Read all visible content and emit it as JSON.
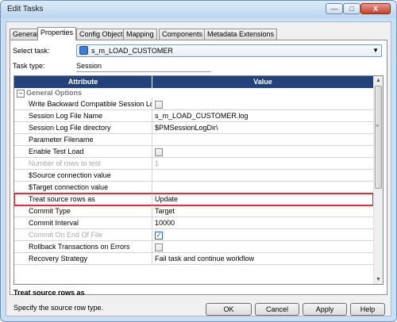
{
  "window": {
    "title": "Edit Tasks",
    "controls": {
      "minimize": "—",
      "maximize": "□",
      "close": "X"
    }
  },
  "tabs": [
    {
      "label": "General"
    },
    {
      "label": "Properties"
    },
    {
      "label": "Config Object"
    },
    {
      "label": "Mapping"
    },
    {
      "label": "Components"
    },
    {
      "label": "Metadata Extensions"
    }
  ],
  "select_task": {
    "label": "Select task:",
    "value": "s_m_LOAD_CUSTOMER"
  },
  "task_type": {
    "label": "Task type:",
    "value": "Session"
  },
  "grid": {
    "headers": {
      "attribute": "Attribute",
      "value": "Value"
    },
    "group": {
      "label": "General Options",
      "toggle": "−"
    },
    "rows": [
      {
        "attribute": "Write Backward Compatible Session Log File",
        "value": "",
        "checkbox": "unchecked"
      },
      {
        "attribute": "Session Log File Name",
        "value": "s_m_LOAD_CUSTOMER.log"
      },
      {
        "attribute": "Session Log File directory",
        "value": "$PMSessionLogDir\\"
      },
      {
        "attribute": "Parameter Filename",
        "value": ""
      },
      {
        "attribute": "Enable Test Load",
        "value": "",
        "checkbox": "unchecked"
      },
      {
        "attribute": "Number of rows to test",
        "value": "1",
        "disabled": true
      },
      {
        "attribute": "$Source connection value",
        "value": ""
      },
      {
        "attribute": "$Target connection value",
        "value": ""
      },
      {
        "attribute": "Treat source rows as",
        "value": "Update",
        "highlighted": true
      },
      {
        "attribute": "Commit Type",
        "value": "Target"
      },
      {
        "attribute": "Commit Interval",
        "value": "10000"
      },
      {
        "attribute": "Commit On End Of File",
        "value": "",
        "checkbox": "checked",
        "disabled": true
      },
      {
        "attribute": "Rollback Transactions on Errors",
        "value": "",
        "checkbox": "unchecked"
      },
      {
        "attribute": "Recovery Strategy",
        "value": "Fail task and continue workflow"
      }
    ],
    "scroll_arrows": {
      "up": "▲",
      "grip": "≡",
      "down": "▼"
    }
  },
  "description": {
    "title": "Treat source rows as",
    "text": "Specify the source row type."
  },
  "buttons": {
    "ok": "OK",
    "cancel": "Cancel",
    "apply": "Apply",
    "help": "Help"
  },
  "colors": {
    "header_bg": "#25417a",
    "highlight_border": "#d9343b",
    "window_frame": "#c9dff3"
  }
}
